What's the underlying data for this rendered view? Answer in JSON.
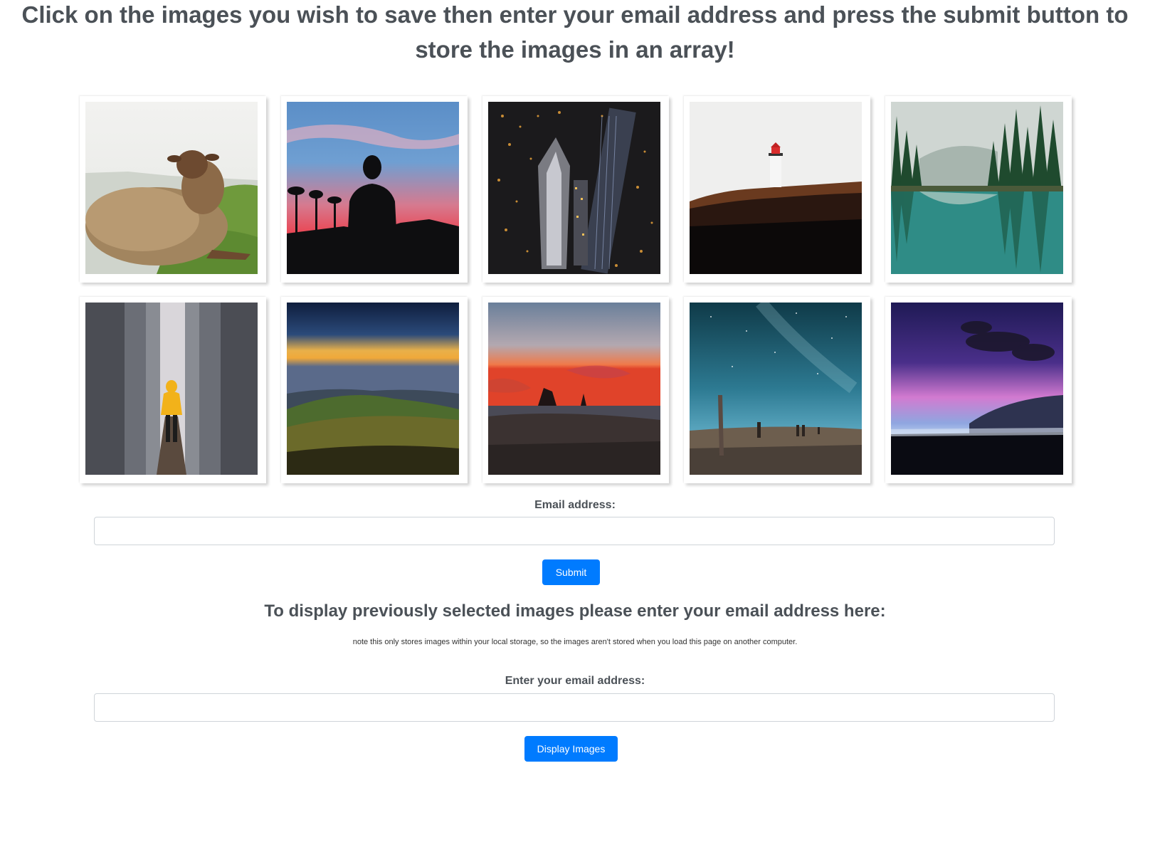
{
  "header": {
    "instructions": "Click on the images you wish to save then enter your email address and press the submit button to store the images in an array!"
  },
  "gallery": {
    "images": [
      {
        "subject": "sheep"
      },
      {
        "subject": "silhouette-sunset"
      },
      {
        "subject": "city-night-aerial"
      },
      {
        "subject": "lighthouse"
      },
      {
        "subject": "forest-lake"
      },
      {
        "subject": "person-concrete-pillars"
      },
      {
        "subject": "hills-dusk"
      },
      {
        "subject": "beach-sea-stacks"
      },
      {
        "subject": "starry-beach"
      },
      {
        "subject": "purple-night-sky"
      }
    ]
  },
  "save_form": {
    "email_label": "Email address:",
    "email_value": "",
    "submit_label": "Submit"
  },
  "display_section": {
    "heading": "To display previously selected images please enter your email address here:",
    "note": "note this only stores images within your local storage, so the images aren't stored when you load this page on another computer.",
    "email_label": "Enter your email address:",
    "email_value": "",
    "display_label": "Display Images"
  },
  "colors": {
    "accent": "#007bff",
    "heading_text": "#4b5157"
  }
}
